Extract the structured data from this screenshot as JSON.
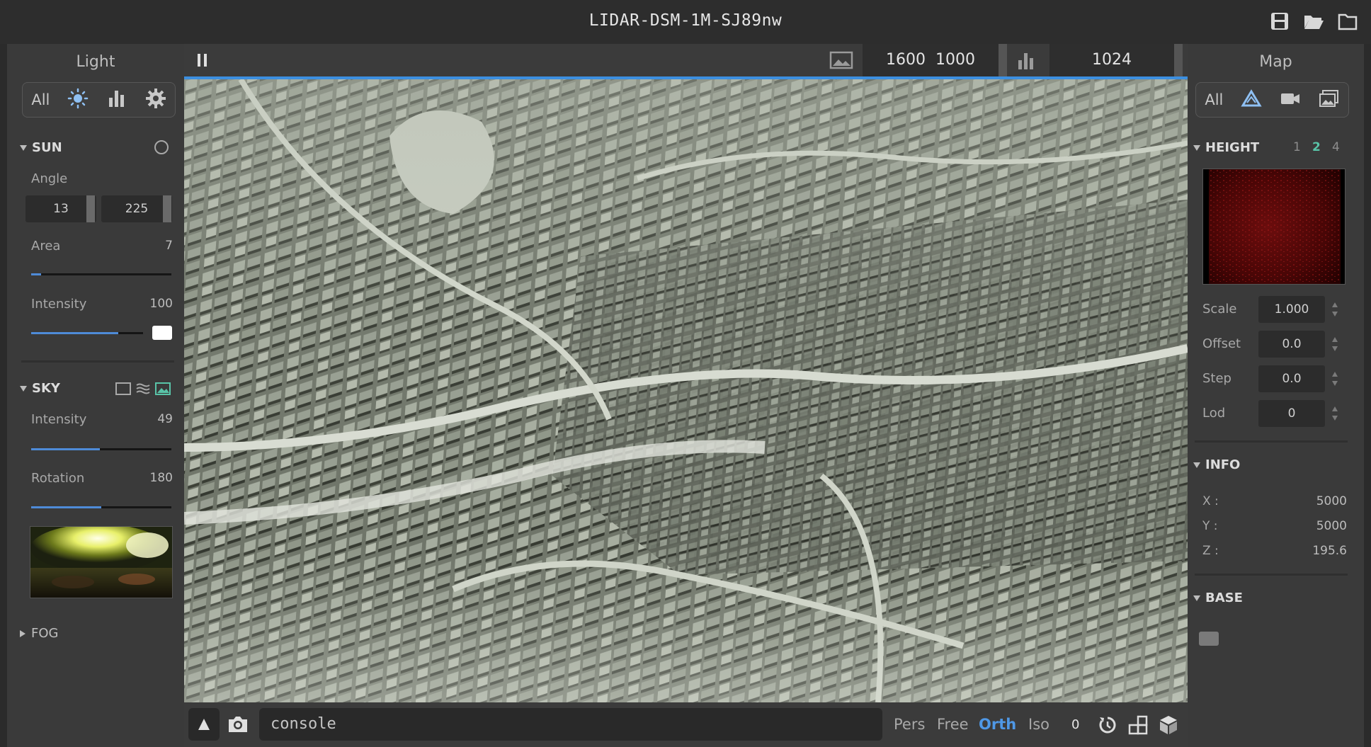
{
  "app_title": "LIDAR-DSM-1M-SJ89nw",
  "titlebar_icons": [
    "save-icon",
    "open-folder-icon",
    "folder-icon"
  ],
  "left_panel": {
    "title": "Light",
    "tabs": {
      "all_label": "All",
      "icons": [
        "sun-icon",
        "bar-chart-icon",
        "gear-icon"
      ]
    },
    "sun": {
      "header": "SUN",
      "angle_label": "Angle",
      "angle_values": [
        "13",
        "225"
      ],
      "area_label": "Area",
      "area_value": "7",
      "area_fraction": 0.07,
      "intensity_label": "Intensity",
      "intensity_value": "100",
      "intensity_fraction": 0.78,
      "color_swatch": "#ffffff"
    },
    "sky": {
      "header": "SKY",
      "intensity_label": "Intensity",
      "intensity_value": "49",
      "intensity_fraction": 0.49,
      "rotation_label": "Rotation",
      "rotation_value": "180",
      "rotation_fraction": 0.5
    },
    "fog": {
      "header": "FOG"
    }
  },
  "viewport": {
    "pause_icon": "pause-icon",
    "res_width": "1600",
    "res_height": "1000",
    "samples": "1024",
    "console_placeholder": "console",
    "modes": [
      "Pers",
      "Free",
      "Orth",
      "Iso"
    ],
    "active_mode": "Orth",
    "counter": "0",
    "accent": "#3c8fe0"
  },
  "right_panel": {
    "title": "Map",
    "tabs": {
      "all_label": "All",
      "icons": [
        "terrain-icon",
        "camera-icon",
        "image-icon"
      ]
    },
    "height": {
      "header": "HEIGHT",
      "levels": [
        "1",
        "2",
        "4"
      ],
      "active_level": "2",
      "scale_label": "Scale",
      "scale_value": "1.000",
      "offset_label": "Offset",
      "offset_value": "0.0",
      "step_label": "Step",
      "step_value": "0.0",
      "lod_label": "Lod",
      "lod_value": "0"
    },
    "info": {
      "header": "INFO",
      "x_label": "X :",
      "x_value": "5000",
      "y_label": "Y :",
      "y_value": "5000",
      "z_label": "Z :",
      "z_value": "195.6"
    },
    "base": {
      "header": "BASE"
    }
  }
}
